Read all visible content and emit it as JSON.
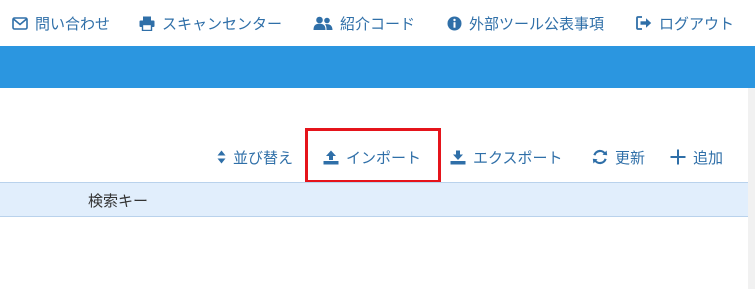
{
  "top_nav": {
    "items": [
      {
        "label": "問い合わせ",
        "icon": "envelope-icon"
      },
      {
        "label": "スキャンセンター",
        "icon": "printer-icon"
      },
      {
        "label": "紹介コード",
        "icon": "users-icon"
      },
      {
        "label": "外部ツール公表事項",
        "icon": "info-circle-icon"
      },
      {
        "label": "ログアウト",
        "icon": "sign-out-icon"
      }
    ]
  },
  "colors": {
    "accent_bar": "#2b96e0",
    "link": "#2f6fa8",
    "highlight": "#e5141b",
    "table_header_bg": "#e1eefc"
  },
  "toolbar": {
    "sort_label": "並び替え",
    "import_label": "インポート",
    "export_label": "エクスポート",
    "refresh_label": "更新",
    "add_label": "追加"
  },
  "table": {
    "columns": [
      "検索キー"
    ]
  }
}
